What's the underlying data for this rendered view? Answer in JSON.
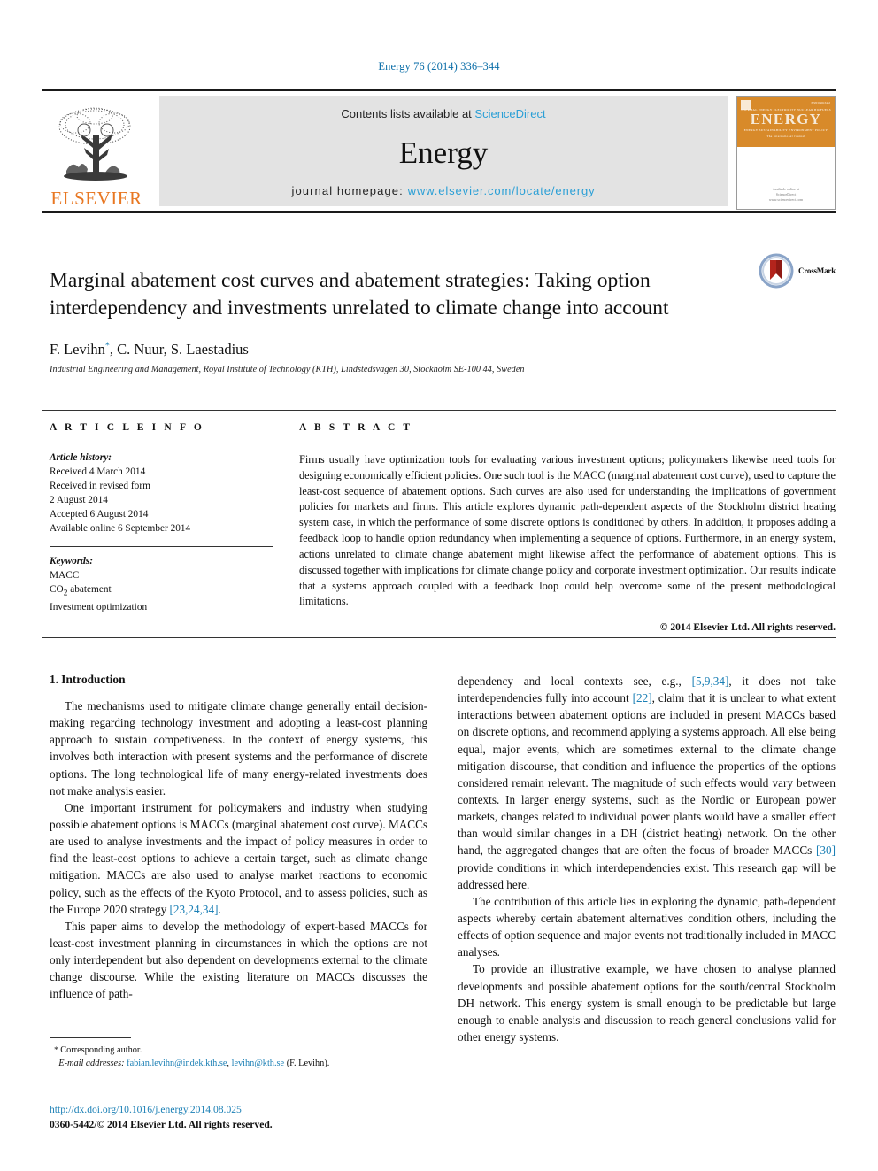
{
  "running_head": "Energy 76 (2014) 336–344",
  "banner": {
    "publisher_name": "ELSEVIER",
    "contents_prefix": "Contents lists available at ",
    "contents_link": "ScienceDirect",
    "journal_name": "Energy",
    "homepage_prefix": "journal homepage: ",
    "homepage_url": "www.elsevier.com/locate/energy",
    "cover_title": "ENERGY",
    "cover_tagline": "The International Journal",
    "cover_footer_prefix": "Available online at",
    "cover_footer_brand": "ScienceDirect",
    "cover_footer_url": "www.sciencedirect.com",
    "cover_corner": "ISSN 0360-5442",
    "cover_row_top": "THERMAL ENERGY    ELECTRICITY    NUCLEAR    BIOFUELS",
    "cover_row_bottom": "ENERGY    SUSTAINABILITY    ENVIRONMENT    POLICY"
  },
  "article": {
    "title": "Marginal abatement cost curves and abatement strategies: Taking option interdependency and investments unrelated to climate change into account",
    "authors": "F. Levihn",
    "author_marker": "*",
    "authors_rest": ", C. Nuur, S. Laestadius",
    "affiliation": "Industrial Engineering and Management, Royal Institute of Technology (KTH), Lindstedsvägen 30, Stockholm SE-100 44, Sweden",
    "crossmark_label": "CrossMark"
  },
  "article_info": {
    "heading": "A R T I C L E   I N F O",
    "history_label": "Article history:",
    "history": [
      "Received 4 March 2014",
      "Received in revised form",
      "2 August 2014",
      "Accepted 6 August 2014",
      "Available online 6 September 2014"
    ],
    "keywords_label": "Keywords:",
    "keywords": [
      "MACC",
      "CO2 abatement",
      "Investment optimization"
    ],
    "keyword_co2_prefix": "CO",
    "keyword_co2_sub": "2",
    "keyword_co2_suffix": " abatement"
  },
  "abstract": {
    "heading": "A B S T R A C T",
    "text": "Firms usually have optimization tools for evaluating various investment options; policymakers likewise need tools for designing economically efficient policies. One such tool is the MACC (marginal abatement cost curve), used to capture the least-cost sequence of abatement options. Such curves are also used for understanding the implications of government policies for markets and firms. This article explores dynamic path-dependent aspects of the Stockholm district heating system case, in which the performance of some discrete options is conditioned by others. In addition, it proposes adding a feedback loop to handle option redundancy when implementing a sequence of options. Furthermore, in an energy system, actions unrelated to climate change abatement might likewise affect the performance of abatement options. This is discussed together with implications for climate change policy and corporate investment optimization. Our results indicate that a systems approach coupled with a feedback loop could help overcome some of the present methodological limitations.",
    "copyright": "© 2014 Elsevier Ltd. All rights reserved."
  },
  "body": {
    "section_heading": "1. Introduction",
    "left_paragraphs": [
      "The mechanisms used to mitigate climate change generally entail decision-making regarding technology investment and adopting a least-cost planning approach to sustain competiveness. In the context of energy systems, this involves both interaction with present systems and the performance of discrete options. The long technological life of many energy-related investments does not make analysis easier.",
      "One important instrument for policymakers and industry when studying possible abatement options is MACCs (marginal abatement cost curve). MACCs are used to analyse investments and the impact of policy measures in order to find the least-cost options to achieve a certain target, such as climate change mitigation. MACCs are also used to analyse market reactions to economic policy, such as the effects of the Kyoto Protocol, and to assess policies, such as the Europe 2020 strategy [23,24,34].",
      "This paper aims to develop the methodology of expert-based MACCs for least-cost investment planning in circumstances in which the options are not only interdependent but also dependent on developments external to the climate change discourse. While the existing literature on MACCs discusses the influence of path-"
    ],
    "left_para2_ref": "[23,24,34]",
    "right_paragraphs": [
      "dependency and local contexts see, e.g., [5,9,34], it does not take interdependencies fully into account [22], claim that it is unclear to what extent interactions between abatement options are included in present MACCs based on discrete options, and recommend applying a systems approach. All else being equal, major events, which are sometimes external to the climate change mitigation discourse, that condition and influence the properties of the options considered remain relevant. The magnitude of such effects would vary between contexts. In larger energy systems, such as the Nordic or European power markets, changes related to individual power plants would have a smaller effect than would similar changes in a DH (district heating) network. On the other hand, the aggregated changes that are often the focus of broader MACCs [30] provide conditions in which interdependencies exist. This research gap will be addressed here.",
      "The contribution of this article lies in exploring the dynamic, path-dependent aspects whereby certain abatement alternatives condition others, including the effects of option sequence and major events not traditionally included in MACC analyses.",
      "To provide an illustrative example, we have chosen to analyse planned developments and possible abatement options for the south/central Stockholm DH network. This energy system is small enough to be predictable but large enough to enable analysis and discussion to reach general conclusions valid for other energy systems."
    ],
    "right_refs": [
      "[5,9,34]",
      "[22]",
      "[30]"
    ]
  },
  "footnotes": {
    "corresponding_marker": "*",
    "corresponding_text": "Corresponding author.",
    "email_label": "E-mail addresses:",
    "email1": "fabian.levihn@indek.kth.se",
    "email_sep": ", ",
    "email2": "levihn@kth.se",
    "email_owner": "(F. Levihn)."
  },
  "doi": {
    "url": "http://dx.doi.org/10.1016/j.energy.2014.08.025",
    "issn_line": "0360-5442/© 2014 Elsevier Ltd. All rights reserved."
  },
  "colors": {
    "link_blue": "#1a7fb5",
    "sciencedirect_blue": "#2a9fd6",
    "elsevier_orange": "#E87722",
    "cover_orange": "#d88a2a",
    "banner_grey": "#e3e3e3"
  }
}
